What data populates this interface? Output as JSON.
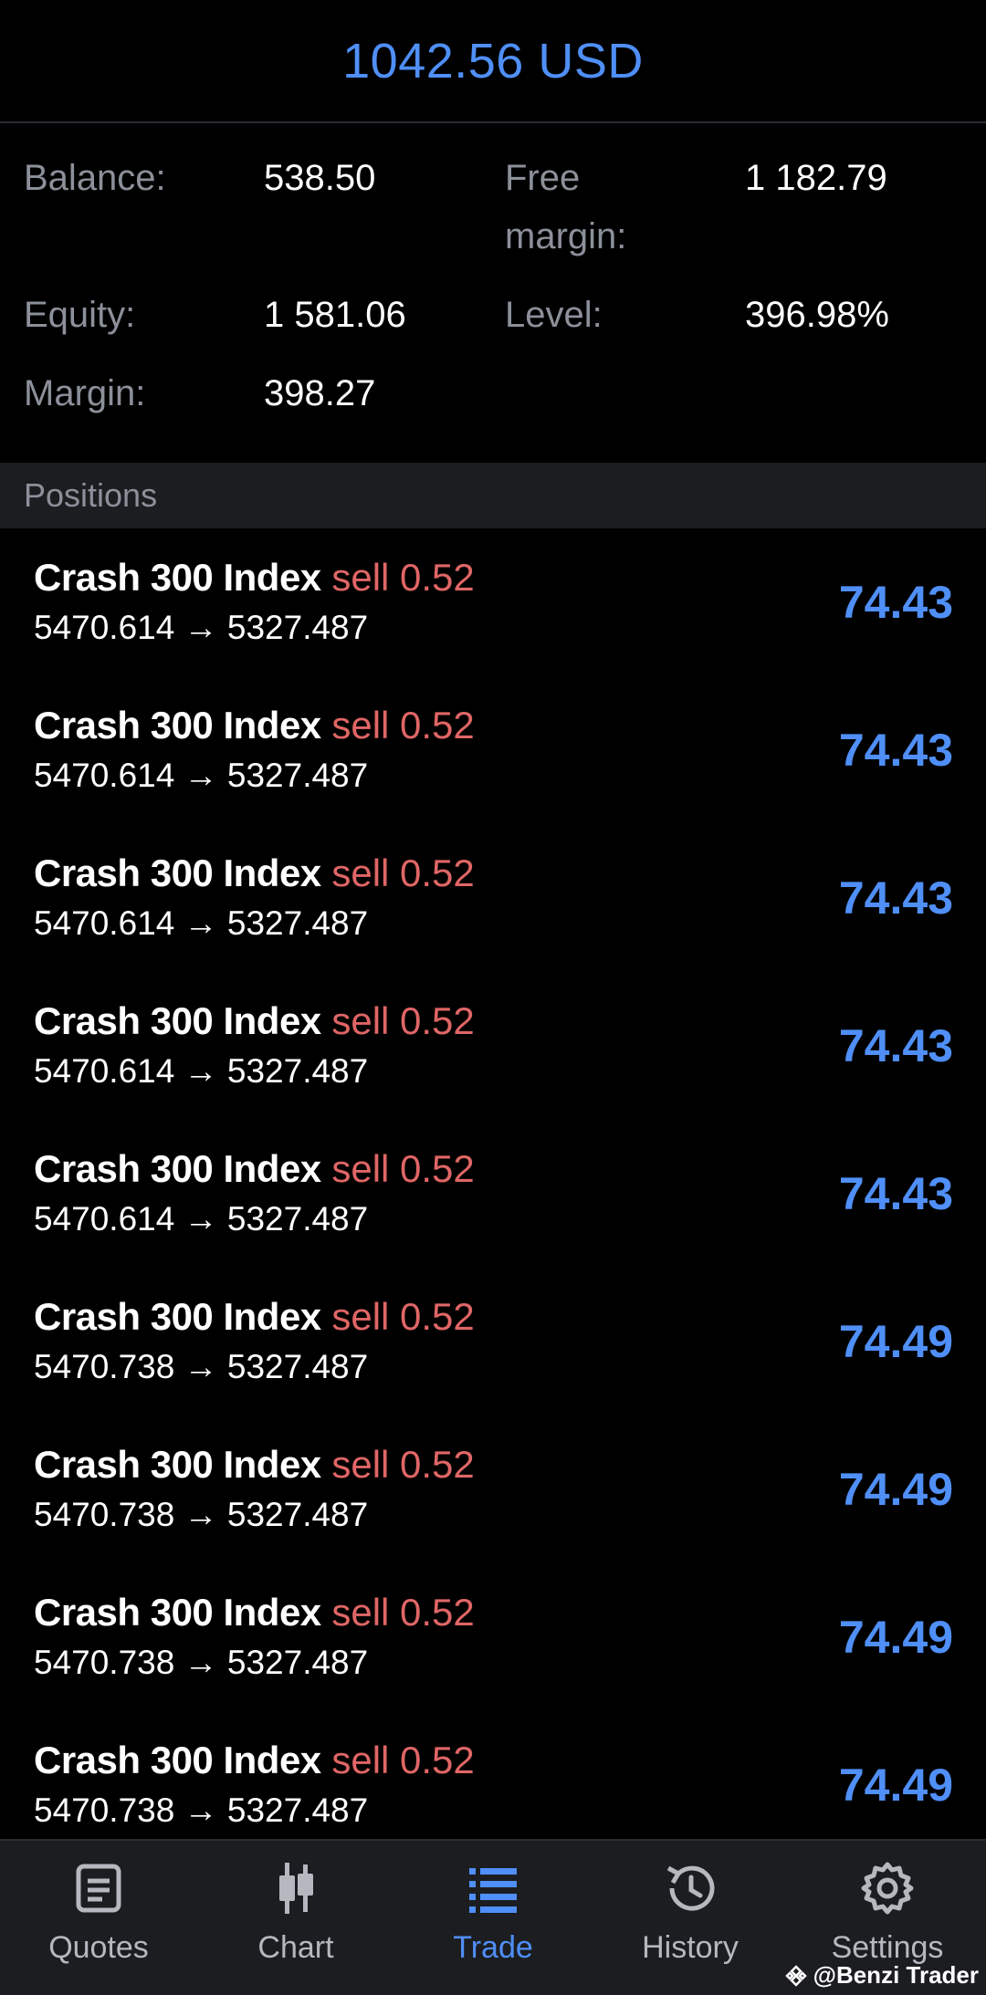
{
  "header": {
    "total": "1042.56 USD"
  },
  "summary": {
    "balance_label": "Balance:",
    "balance_value": "538.50",
    "free_margin_label": "Free margin:",
    "free_margin_value": "1 182.79",
    "equity_label": "Equity:",
    "equity_value": "1 581.06",
    "level_label": "Level:",
    "level_value": "396.98%",
    "margin_label": "Margin:",
    "margin_value": "398.27"
  },
  "positions_header": "Positions",
  "positions": [
    {
      "symbol": "Crash 300 Index",
      "side": "sell 0.52",
      "prices": "5470.614 → 5327.487",
      "profit": "74.43"
    },
    {
      "symbol": "Crash 300 Index",
      "side": "sell 0.52",
      "prices": "5470.614 → 5327.487",
      "profit": "74.43"
    },
    {
      "symbol": "Crash 300 Index",
      "side": "sell 0.52",
      "prices": "5470.614 → 5327.487",
      "profit": "74.43"
    },
    {
      "symbol": "Crash 300 Index",
      "side": "sell 0.52",
      "prices": "5470.614 → 5327.487",
      "profit": "74.43"
    },
    {
      "symbol": "Crash 300 Index",
      "side": "sell 0.52",
      "prices": "5470.614 → 5327.487",
      "profit": "74.43"
    },
    {
      "symbol": "Crash 300 Index",
      "side": "sell 0.52",
      "prices": "5470.738 → 5327.487",
      "profit": "74.49"
    },
    {
      "symbol": "Crash 300 Index",
      "side": "sell 0.52",
      "prices": "5470.738 → 5327.487",
      "profit": "74.49"
    },
    {
      "symbol": "Crash 300 Index",
      "side": "sell 0.52",
      "prices": "5470.738 → 5327.487",
      "profit": "74.49"
    },
    {
      "symbol": "Crash 300 Index",
      "side": "sell 0.52",
      "prices": "5470.738 → 5327.487",
      "profit": "74.49"
    }
  ],
  "nav": {
    "items": [
      {
        "label": "Quotes",
        "icon": "quotes-icon"
      },
      {
        "label": "Chart",
        "icon": "chart-icon"
      },
      {
        "label": "Trade",
        "icon": "trade-icon",
        "active": true
      },
      {
        "label": "History",
        "icon": "history-icon"
      },
      {
        "label": "Settings",
        "icon": "settings-icon"
      }
    ]
  },
  "watermark": "@Benzi Trader",
  "colors": {
    "accent": "#4f8ff7",
    "sell": "#e06666",
    "label": "#8c909a",
    "background": "#000000",
    "panel": "#1c1d21"
  }
}
